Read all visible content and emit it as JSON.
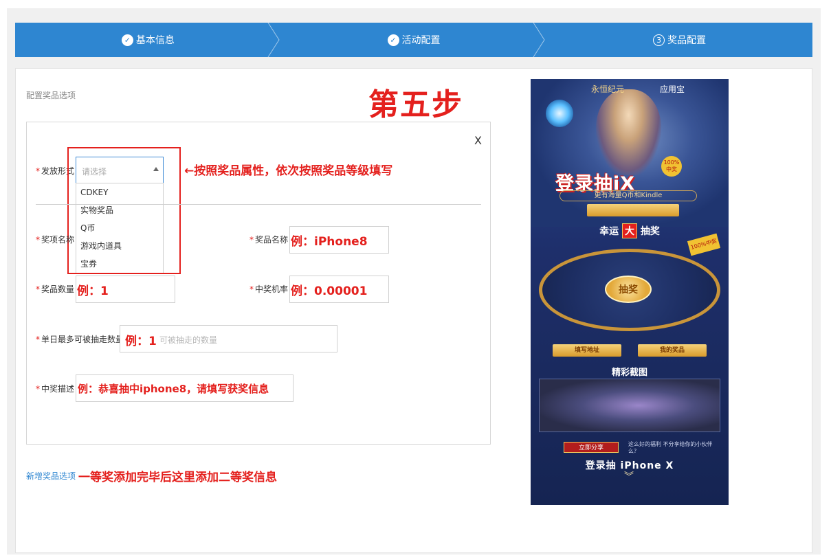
{
  "steps": [
    {
      "label": "基本信息",
      "state": "done",
      "icon": "check-icon"
    },
    {
      "label": "活动配置",
      "state": "done",
      "icon": "check-icon"
    },
    {
      "label": "奖品配置",
      "state": "current",
      "number": "3"
    }
  ],
  "colors": {
    "accent": "#2e86d1",
    "annotation": "#e4201d"
  },
  "section_title": "配置奖品选项",
  "big_step": "第五步",
  "close_label": "X",
  "form": {
    "issue_type": {
      "label": "发放形式",
      "placeholder": "请选择",
      "options": [
        "CDKEY",
        "实物奖品",
        "Q币",
        "游戏内道具",
        "宝券"
      ]
    },
    "item_name": {
      "label": "奖项名称"
    },
    "prize_name": {
      "label": "奖品名称",
      "example": "例：iPhone8"
    },
    "prize_quantity": {
      "label": "奖品数量",
      "example": "例：1"
    },
    "win_rate": {
      "label": "中奖机率",
      "example": "例：0.00001"
    },
    "max_per_day": {
      "label": "单日最多可被抽走数量",
      "placeholder": "可被抽走的数量",
      "example": "例：1"
    },
    "win_desc": {
      "label": "中奖描述",
      "example": "例：恭喜抽中iphone8，请填写获奖信息"
    }
  },
  "annotations": {
    "issue_type": "←按照奖品属性，依次按照奖品等级填写",
    "add_prize": "一等奖添加完毕后这里添加二等奖信息"
  },
  "add_prize_link": "新增奖品选项",
  "preview": {
    "logo_game": "永恒纪元",
    "logo_store": "应用宝",
    "title": "登录抽iX",
    "badge": "100%中奖",
    "subtitle": "更有海量Q币和Kindle",
    "luck_pre": "幸运",
    "luck_big": "大",
    "luck_post": "抽奖",
    "wheel_center": "抽奖",
    "btn_address": "填写地址",
    "btn_my_prize": "我的奖品",
    "section_screenshots": "精彩截图",
    "share_btn": "立即分享",
    "share_text": "这么好的福利 不分享给你的小伙伴么？",
    "bottom_title": "登录抽 iPhone X"
  }
}
